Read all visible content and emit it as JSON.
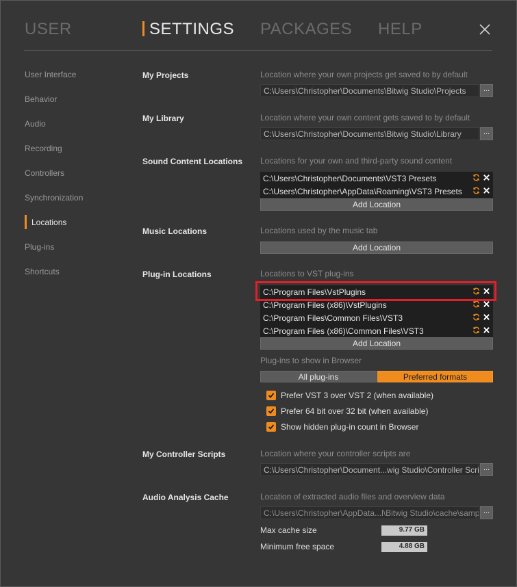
{
  "tabs": [
    {
      "label": "USER"
    },
    {
      "label": "SETTINGS"
    },
    {
      "label": "PACKAGES"
    },
    {
      "label": "HELP"
    }
  ],
  "sidebar": {
    "items": [
      {
        "label": "User Interface"
      },
      {
        "label": "Behavior"
      },
      {
        "label": "Audio"
      },
      {
        "label": "Recording"
      },
      {
        "label": "Controllers"
      },
      {
        "label": "Synchronization"
      },
      {
        "label": "Locations"
      },
      {
        "label": "Plug-ins"
      },
      {
        "label": "Shortcuts"
      }
    ],
    "active": "Locations"
  },
  "my_projects": {
    "title": "My Projects",
    "description": "Location where your own projects get saved to by default",
    "path": "C:\\Users\\Christopher\\Documents\\Bitwig Studio\\Projects",
    "browse_label": "..."
  },
  "my_library": {
    "title": "My Library",
    "description": "Location where your own content gets saved to by default",
    "path": "C:\\Users\\Christopher\\Documents\\Bitwig Studio\\Library",
    "browse_label": "..."
  },
  "sound_content": {
    "title": "Sound Content Locations",
    "description": "Locations for your own and third-party sound content",
    "paths": [
      "C:\\Users\\Christopher\\Documents\\VST3 Presets",
      "C:\\Users\\Christopher\\AppData\\Roaming\\VST3 Presets"
    ],
    "add_label": "Add Location"
  },
  "music_locations": {
    "title": "Music Locations",
    "description": "Locations used by the music tab",
    "add_label": "Add Location"
  },
  "plugin_locations": {
    "title": "Plug-in Locations",
    "description": "Locations to VST plug-ins",
    "paths": [
      "C:\\Program Files\\VstPlugins",
      "C:\\Program Files (x86)\\VstPlugins",
      "C:\\Program Files\\Common Files\\VST3",
      "C:\\Program Files (x86)\\Common Files\\VST3"
    ],
    "add_label": "Add Location",
    "show_label": "Plug-ins to show in Browser",
    "filter_all": "All plug-ins",
    "filter_preferred": "Preferred formats",
    "options": [
      {
        "label": "Prefer VST 3 over VST 2 (when available)",
        "checked": true
      },
      {
        "label": "Prefer 64 bit over 32 bit (when available)",
        "checked": true
      },
      {
        "label": "Show hidden plug-in count in Browser",
        "checked": true
      }
    ]
  },
  "controller_scripts": {
    "title": "My Controller Scripts",
    "description": "Location where your controller scripts are",
    "path": "C:\\Users\\Christopher\\Document...wig Studio\\Controller Scripts",
    "browse_label": "..."
  },
  "audio_cache": {
    "title": "Audio Analysis Cache",
    "description": "Location of extracted audio files and overview data",
    "path": "C:\\Users\\Christopher\\AppData...l\\Bitwig Studio\\cache\\samples",
    "browse_label": "...",
    "max_cache_label": "Max cache size",
    "max_cache_value": "9.77 GB",
    "min_free_label": "Minimum free space",
    "min_free_value": "4.88 GB"
  },
  "colors": {
    "accent": "#f08c1e",
    "highlight_box": "#e0202a",
    "background": "#363636"
  }
}
